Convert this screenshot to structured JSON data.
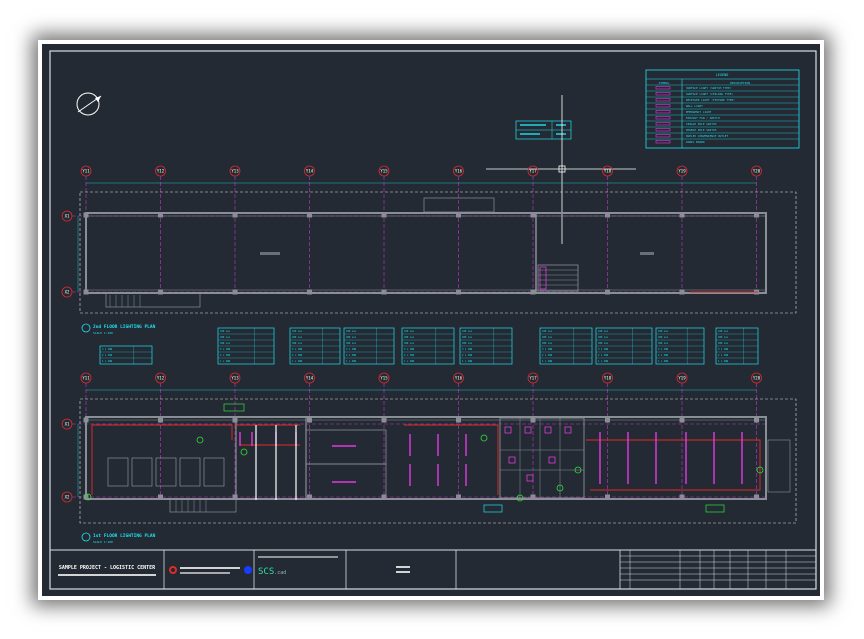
{
  "legend": {
    "title": "LEGEND",
    "headers": [
      "SYMBOL",
      "DESCRIPTION"
    ],
    "rows": [
      "SURFACE LIGHT (SWITCH TYPE)",
      "SURFACE LIGHT (CEILING TYPE)",
      "RECESSED LIGHT (FIXTURE TYPE)",
      "WALL LIGHT",
      "EMERGENCY LIGHT",
      "EXHAUST FAN / SWITCH",
      "SINGLE POLE SWITCH",
      "DOUBLE POLE SWITCH",
      "DUPLEX CONVENIENCE OUTLET",
      "PANEL BOARD"
    ]
  },
  "grid_columns": [
    "Y11",
    "Y12",
    "Y13",
    "Y14",
    "Y15",
    "Y16",
    "Y17",
    "Y18",
    "Y19",
    "Y20"
  ],
  "grid_rows": [
    "X1",
    "X2"
  ],
  "plans": {
    "upper": {
      "title": "2nd FLOOR LIGHTING PLAN",
      "sub": "SCALE 1:100"
    },
    "lower": {
      "title": "1st FLOOR LIGHTING PLAN",
      "sub": "SCALE 1:100"
    }
  },
  "schedule_values": [
    "3 x 18W",
    "2 x 36W",
    "1 x 40W",
    "100 Lux",
    "200 Lux",
    "300 Lux"
  ],
  "title_block": {
    "project": "SAMPLE PROJECT - LOGISTIC CENTER",
    "logo": "SCS",
    "logo_suffix": ".cad"
  },
  "colors": {
    "background": "#232a33",
    "frame": "#d7dde4",
    "cyan": "#1fe2f0",
    "magenta": "#e23ae0",
    "red": "#e02a2a",
    "green": "#33e03a",
    "grey": "#8a8f96"
  }
}
